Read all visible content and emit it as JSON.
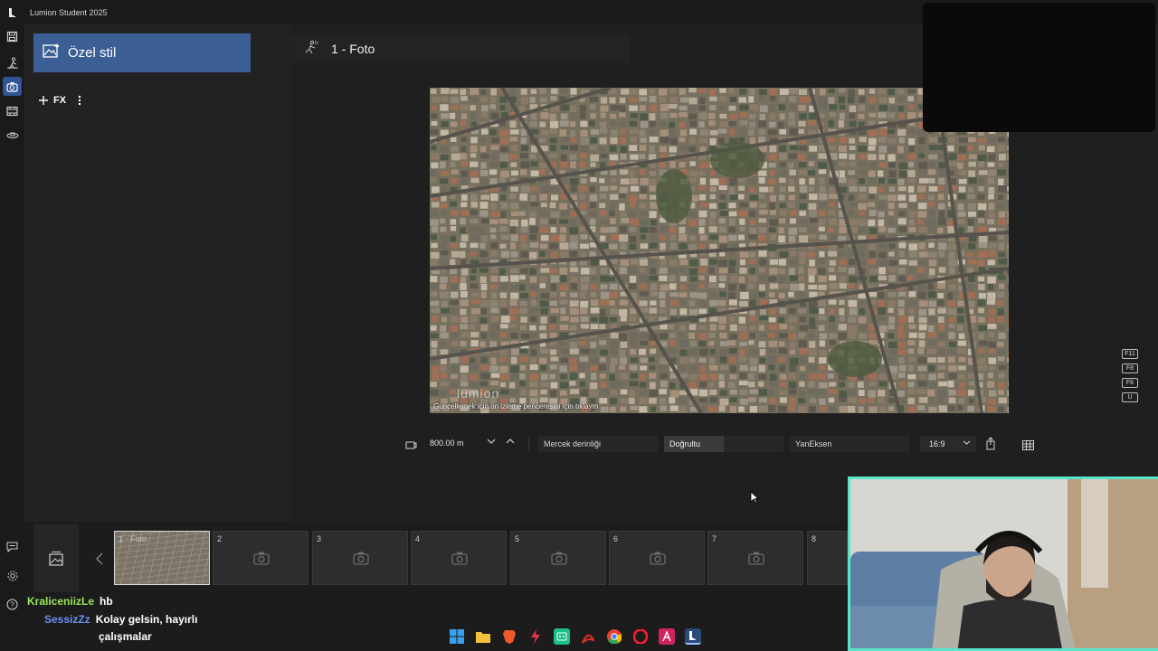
{
  "window": {
    "title": "Lumion Student 2025"
  },
  "rail": {
    "items": [
      {
        "name": "save-icon"
      },
      {
        "name": "build-mode-icon"
      },
      {
        "name": "photo-mode-icon",
        "active": true
      },
      {
        "name": "movie-mode-icon"
      },
      {
        "name": "360-panorama-icon"
      }
    ],
    "bottom": [
      {
        "name": "chat-icon"
      },
      {
        "name": "settings-icon"
      },
      {
        "name": "help-icon"
      }
    ]
  },
  "left_panel": {
    "style_button_label": "Özel stil",
    "fx_label": "FX"
  },
  "main": {
    "photo_title": "1 - Foto",
    "viewport_watermark": "lumion",
    "viewport_hint": "Güncellemek için ön izleme penceresini için tıklayın"
  },
  "shortcut_keys": [
    "F11",
    "F8",
    "F6",
    "U"
  ],
  "toolbar": {
    "distance": "800.00 m",
    "depth_of_field": "Mercek derinliği",
    "straighten": "Doğrultu",
    "side_axis": "YanEksen",
    "aspect_ratio": "16:9"
  },
  "filmstrip": {
    "slots": [
      {
        "label": "1 - Foto",
        "filled": true
      },
      {
        "label": "2"
      },
      {
        "label": "3"
      },
      {
        "label": "4"
      },
      {
        "label": "5"
      },
      {
        "label": "6"
      },
      {
        "label": "7"
      },
      {
        "label": "8"
      }
    ]
  },
  "chat": {
    "messages": [
      {
        "user": "KraliceniizLe",
        "text": "hb"
      },
      {
        "user": "SessizZz",
        "text": "Kolay gelsin, hayırlı",
        "text_cont": "çalışmalar"
      }
    ]
  },
  "colors": {
    "accent": "#3b5f95",
    "webcam_border": "#58e6c8"
  }
}
